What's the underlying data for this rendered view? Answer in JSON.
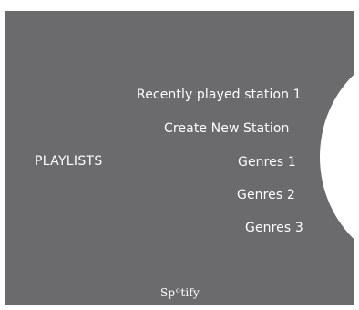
{
  "menu": {
    "left_label": "PLAYLISTS",
    "items": [
      {
        "label": "Recently played station 1"
      },
      {
        "label": "Create New Station"
      },
      {
        "label": "Genres 1"
      },
      {
        "label": "Genres 2"
      },
      {
        "label": "Genres 3"
      }
    ]
  },
  "brand": {
    "logo_prefix": "Sp",
    "logo_o": "o",
    "logo_suffix": "tify"
  },
  "colors": {
    "background": "#6b6b6e",
    "text": "#ffffff",
    "knob": "#ffffff"
  }
}
